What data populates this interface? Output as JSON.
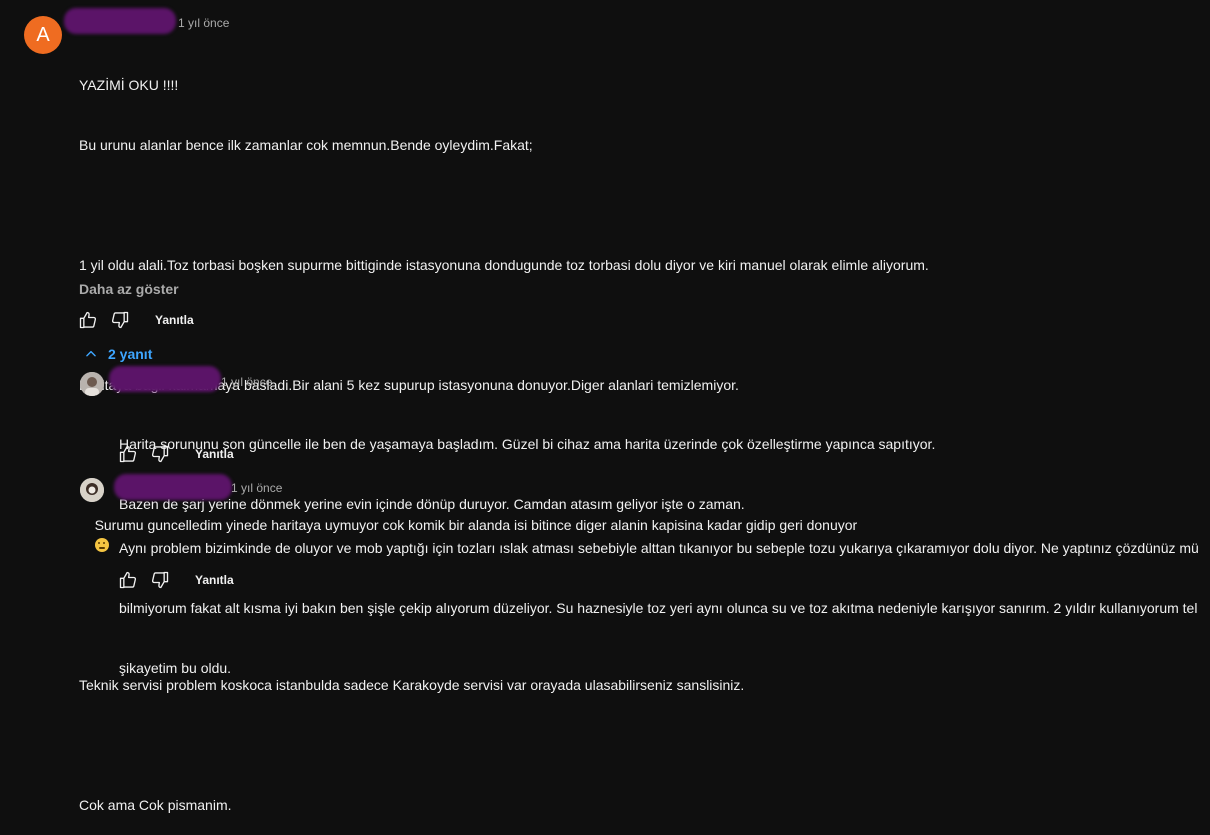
{
  "main_comment": {
    "avatar_letter": "A",
    "timestamp": "1 yıl önce",
    "paragraphs": [
      "YAZİMİ OKU !!!!",
      "Bu urunu alanlar bence ilk zamanlar cok memnun.Bende oyleydim.Fakat;",
      "",
      "1 yil oldu alali.Toz torbasi boşken supurme bittiginde istasyonuna dondugunde toz torbasi dolu diyor ve kiri manuel olarak elimle aliyorum.",
      "",
      "Haritaya bagli kalmamaya basladi.Bir alani 5 kez supurup istasyonuna donuyor.Diger alanlari temizlemiyor.",
      "",
      "Surumu guncelledim yinede haritaya uymuyor cok komik bir alanda isi bitince diger alanin kapisina kadar gidip geri donuyor",
      "",
      "Teknik servisi problem koskoca istanbulda sadece Karakoyde servisi var orayada ulasabilirseniz sanslisiniz.",
      "",
      "Cok ama Cok pismanim."
    ],
    "show_less": "Daha az göster",
    "reply_label": "Yanıtla"
  },
  "replies_toggle": {
    "label": "2 yanıt"
  },
  "replies": [
    {
      "timestamp": "1 yıl önce",
      "line1": "Harita sorununu son güncelle ile ben de yaşamaya başladım. Güzel bi cihaz ama harita üzerinde çok özelleştirme yapınca sapıtıyor.",
      "line2": "Bazen de şarj yerine dönmek yerine evin içinde dönüp duruyor. Camdan atasım geliyor işte o zaman.",
      "reply_label": "Yanıtla"
    },
    {
      "timestamp": "1 yıl önce",
      "line1": "Aynı problem bizimkinde de oluyor ve mob yaptığı için tozları ıslak atması sebebiyle alttan tıkanıyor bu sebeple tozu yukarıya çıkaramıyor dolu diyor. Ne yaptınız çözdünüz mü",
      "line2": "bilmiyorum fakat alt kısma iyi bakın ben şişle çekip alıyorum düzeliyor. Su haznesiyle toz yeri aynı olunca su ve toz akıtma nedeniyle karışıyor sanırım. 2 yıldır kullanıyorum tel",
      "line3": "şikayetim bu oldu.",
      "reply_label": "Yanıtla"
    }
  ],
  "icons": {
    "like": "thumbs-up-icon",
    "dislike": "thumbs-down-icon",
    "chevron": "chevron-up-icon",
    "emoji": "thinking-face-emoji"
  },
  "colors": {
    "background": "#0f0f0f",
    "avatar": "#ef6c21",
    "link": "#3ea6ff",
    "redaction": "#5b1468"
  }
}
